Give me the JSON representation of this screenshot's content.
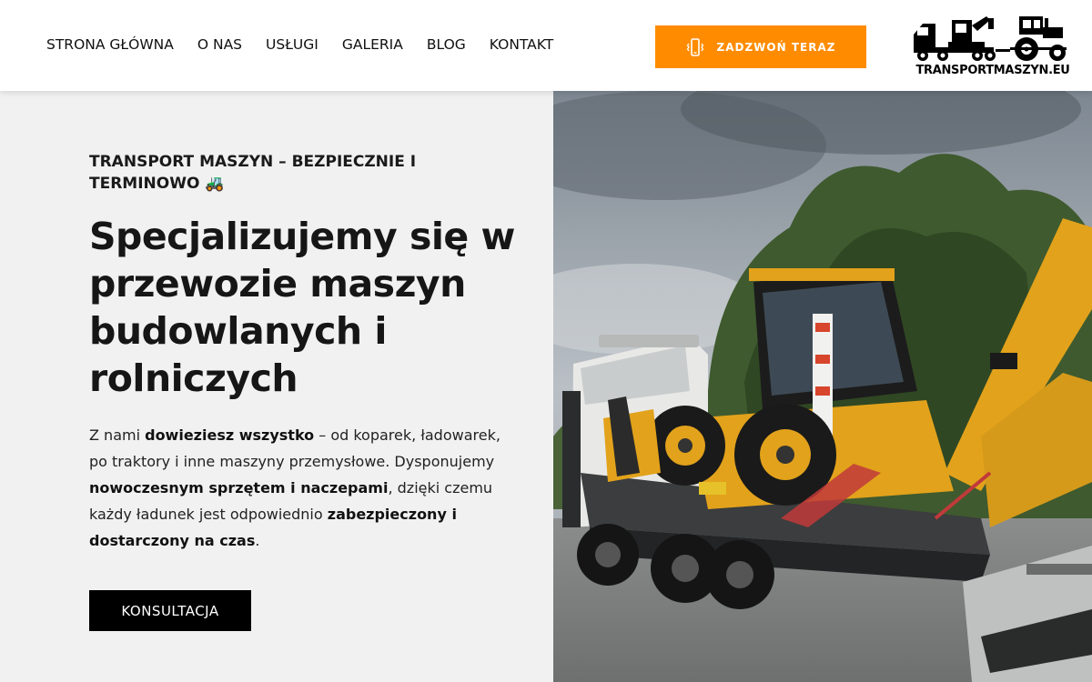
{
  "nav": {
    "items": [
      {
        "label": "STRONA GŁÓWNA"
      },
      {
        "label": "O NAS"
      },
      {
        "label": "USŁUGI"
      },
      {
        "label": "GALERIA"
      },
      {
        "label": "BLOG"
      },
      {
        "label": "KONTAKT"
      }
    ]
  },
  "header": {
    "call_label": "ZADZWOŃ TERAZ",
    "logo_text": "TRANSPORTMASZYN.EU"
  },
  "hero": {
    "eyebrow": "TRANSPORT MASZYN – BEZPIECZNIE I TERMINOWO 🚜",
    "headline": "Specjalizujemy się w przewozie maszyn budowlanych i rolniczych",
    "body": {
      "p1": "Z nami ",
      "b1": "dowieziesz wszystko",
      "p2": " – od koparek, ładowarek, po traktory i inne maszyny przemysłowe. Dysponujemy ",
      "b2": "nowoczesnym sprzętem i naczepami",
      "p3": ", dzięki czemu każdy ładunek jest odpowiednio ",
      "b3": "zabezpieczony i dostarczony na czas",
      "p4": "."
    },
    "cta_label": "KONSULTACJA"
  },
  "colors": {
    "accent": "#ff8c00",
    "machine_yellow": "#e8a91c",
    "hero_bg": "#f1f1f1",
    "cta_bg": "#000000"
  },
  "icons": {
    "call": "phone-vibrate-icon",
    "logo": "truck-tractor-logo"
  }
}
